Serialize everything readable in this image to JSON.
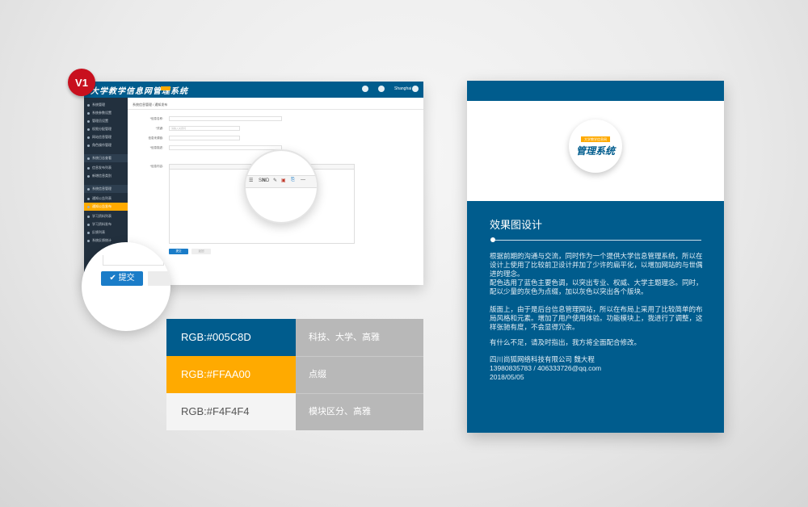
{
  "badge": {
    "label": "V1"
  },
  "mockup": {
    "app_title": "大学教学信息网管理系统",
    "user": "Shanghai",
    "sidebar": [
      {
        "label": "系统管理",
        "type": "item"
      },
      {
        "label": "系统参数设置",
        "type": "item"
      },
      {
        "label": "管理员设置",
        "type": "item"
      },
      {
        "label": "权限分配管理",
        "type": "item"
      },
      {
        "label": "网站信息管理",
        "type": "item"
      },
      {
        "label": "角色操作管理",
        "type": "item"
      },
      {
        "label": "系统日志查看",
        "type": "head"
      },
      {
        "label": "信息发布列表",
        "type": "item"
      },
      {
        "label": "新增信息类别",
        "type": "item"
      },
      {
        "label": "系统信息管理",
        "type": "head"
      },
      {
        "label": "通知公告列表",
        "type": "item"
      },
      {
        "label": "通知公告发布",
        "type": "active"
      },
      {
        "label": "学习资料列表",
        "type": "item"
      },
      {
        "label": "学习资料发布",
        "type": "item"
      },
      {
        "label": "反馈列表",
        "type": "item"
      },
      {
        "label": "系统反馈统计",
        "type": "item"
      }
    ],
    "breadcrumb": "系统信息管理  /  通知发布",
    "form": {
      "label_name": "*信息名称:",
      "label_keywords": "*关键:",
      "placeholder_keywords": "请输入关键词",
      "label_link": "信息来源链:",
      "label_desc": "*信息描述:",
      "label_content": "*信息内容:"
    },
    "submit_label": "提交",
    "cancel_label": "返回"
  },
  "zoom": {
    "toolbar_items": [
      "☰",
      "S𝗡D",
      "✎",
      "▣",
      "⎘",
      "—"
    ],
    "submit_label": "✔ 提交"
  },
  "swatches": [
    {
      "code": "RGB:#005C8D",
      "desc": "科技、大学、高雅",
      "color": "#005C8D",
      "text_color": "#ffffff"
    },
    {
      "code": "RGB:#FFAA00",
      "desc": "点缀",
      "color": "#FFAA00",
      "text_color": "#ffffff"
    },
    {
      "code": "RGB:#F4F4F4",
      "desc": "模块区分、高雅",
      "color": "#F4F4F4",
      "text_color": "#555555"
    }
  ],
  "card": {
    "logo_tag": "大学教学信息网",
    "logo_text": "管理系统",
    "heading": "效果图设计",
    "paragraphs": [
      "根据前期的沟通与交流，同时作为一个提供大学信息管理系统，所以在设计上使用了比较前卫设计并加了少许的扁平化，以增加网站的与世偶进的理念。",
      "配色选用了蓝色主要色调，以突出专业、权威、大学主题理念。同时，配以少量的灰色为点缀，加以灰色以突出各个版块。",
      "版面上，由于是后台信息管理网站，所以在布局上采用了比较简单的布局风格和元素。增加了用户使用体验。功能模块上，我进行了调整，这样张驰有度，不会显得冗余。",
      "有什么不足，请及时指出，我方将全面配合修改。"
    ],
    "company": "四川尚狐网络科技有限公司 魏大程",
    "contact": "13980835783  / 406333726@qq.com",
    "date": "2018/05/05"
  }
}
